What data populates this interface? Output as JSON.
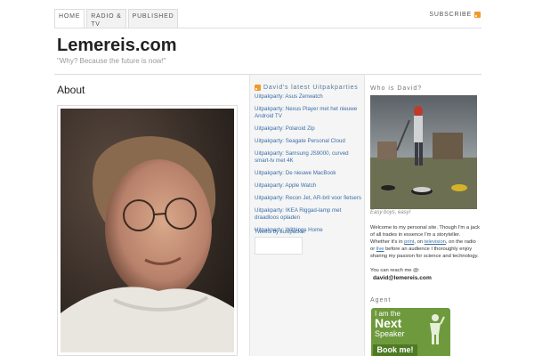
{
  "nav": {
    "tabs": [
      {
        "label": "HOME"
      },
      {
        "label": "RADIO &\nTV"
      },
      {
        "label": "PUBLISHED"
      }
    ],
    "subscribe_label": "SUBSCRIBE"
  },
  "header": {
    "site_title": "Lemereis.com",
    "tagline": "\"Why? Because the future is now!\""
  },
  "main": {
    "title": "About"
  },
  "middle": {
    "heading": "David's latest Uitpakparties",
    "items": [
      "Uitpakparty: Asus Zenwatch",
      "Uitpakparty: Nexus Player met het nieuwe Android TV",
      "Uitpakparty: Polaroid Zip",
      "Uitpakparty: Seagate Personal Cloud",
      "Uitpakparty: Samsung JS9000, curved smart-tv met 4K",
      "Uitpakparty: De nieuwe MacBook",
      "Uitpakparty: Apple Watch",
      "Uitpakparty: Recon Jet, AR-bril voor fietsers",
      "Uitpakparty: IKEA Riggad-lamp met draadloos opladen",
      "Uitpakparty: Withings Home"
    ],
    "tweets_label": "Tweets by susipacker"
  },
  "right": {
    "who_heading": "Who is David?",
    "caption": "Easy boys, easy!",
    "bio_1": "Welcome to my personal site. Though I'm a jack of all trades in essence I'm a storyteller. Whether it's in ",
    "bio_print": "print",
    "bio_2": ", on ",
    "bio_tv": "television",
    "bio_3": ", on the radio or ",
    "bio_live": "live",
    "bio_4": " before an audience I thoroughly enjoy sharing my passion for science and technology.",
    "reach_label": "You can reach me @:",
    "email": "david@lemereis.com",
    "agent_heading": "Agent",
    "badge": {
      "line1": "I am the",
      "line2": "Next",
      "line3": "Speaker",
      "button": "Book me!"
    }
  },
  "colors": {
    "link": "#3a6fa8",
    "rss": "#f09a2a",
    "badge_green": "#6e9a3d"
  }
}
